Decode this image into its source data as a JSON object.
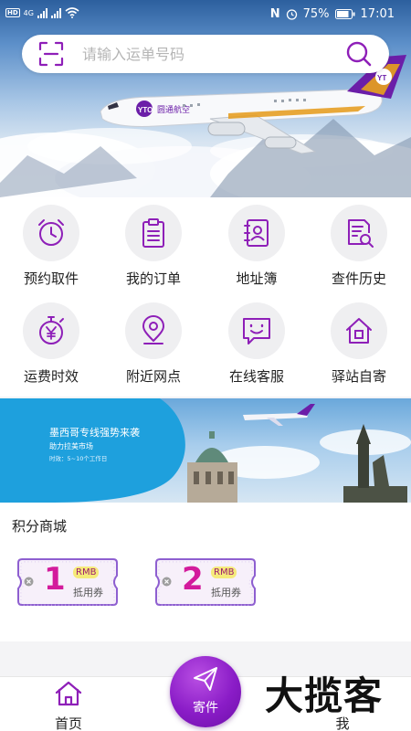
{
  "status_bar": {
    "battery": "75%",
    "time": "17:01",
    "network": "4G"
  },
  "search": {
    "placeholder": "请输入运单号码"
  },
  "hero": {
    "airline_label": "圆通航空",
    "logo_text": "YTO"
  },
  "services": [
    {
      "label": "预约取件",
      "icon": "alarm-clock-icon"
    },
    {
      "label": "我的订单",
      "icon": "clipboard-icon"
    },
    {
      "label": "地址簿",
      "icon": "contact-book-icon"
    },
    {
      "label": "查件历史",
      "icon": "document-search-icon"
    },
    {
      "label": "运费时效",
      "icon": "yuan-stopwatch-icon"
    },
    {
      "label": "附近网点",
      "icon": "map-pin-icon"
    },
    {
      "label": "在线客服",
      "icon": "chat-smile-icon"
    },
    {
      "label": "驿站自寄",
      "icon": "house-icon"
    }
  ],
  "banner": {
    "title": "墨西哥专线强势来袭",
    "subtitle": "助力拉美市场",
    "timing": "时效：5~10个工作日"
  },
  "mall": {
    "title": "积分商城",
    "coupons": [
      {
        "value": "1",
        "currency": "RMB",
        "label": "抵用券"
      },
      {
        "value": "2",
        "currency": "RMB",
        "label": "抵用券"
      }
    ]
  },
  "nav": {
    "home": "首页",
    "send": "寄件",
    "me": "我"
  },
  "watermark": "大揽客",
  "colors": {
    "brand_purple": "#8a1cc7",
    "icon_purple": "#8e1fb8",
    "coupon_magenta": "#d31b9c"
  }
}
